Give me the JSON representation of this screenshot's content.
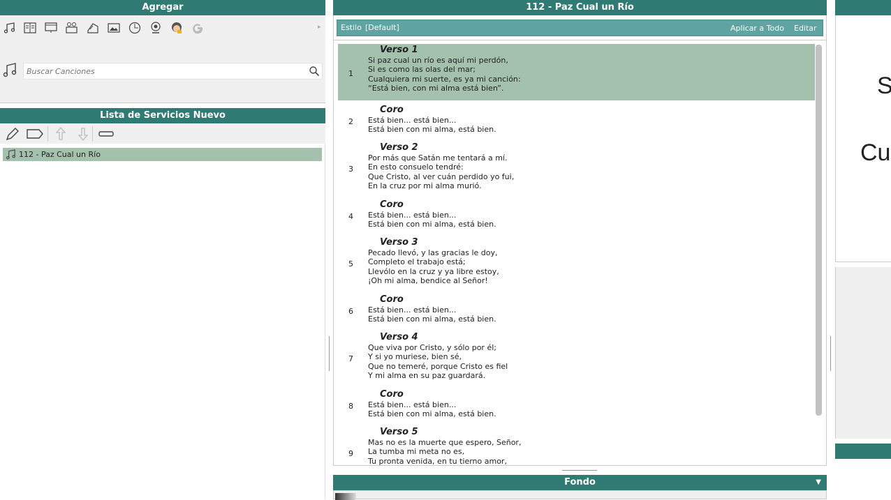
{
  "left": {
    "add_title": "Agregar",
    "search_placeholder": "Buscar Canciones",
    "service_title": "Lista de Servicios Nuevo",
    "service_items": [
      "112 - Paz Cual un Río"
    ]
  },
  "center": {
    "song_title": "112 - Paz Cual un Río",
    "style_label": "Estilo",
    "style_value": "[Default]",
    "apply_all": "Aplicar a Todo",
    "edit": "Editar",
    "verses": [
      {
        "num": "1",
        "title": "Verso 1",
        "lines": [
          "Si paz cual un río es aquí mi perdón,",
          "Si es como las olas del mar;",
          "Cualquiera mi suerte, es ya mi canción:",
          "“Está bien, con mi alma está bien”."
        ]
      },
      {
        "num": "2",
        "title": "Coro",
        "lines": [
          "Está bien... está bien...",
          "Está bien con mi alma, está bien."
        ]
      },
      {
        "num": "3",
        "title": "Verso 2",
        "lines": [
          "Por más que Satán me tentará a mí.",
          "En esto consuelo tendré:",
          "Que Cristo, al ver cuán perdido yo fui,",
          "En la cruz por mi alma murió."
        ]
      },
      {
        "num": "4",
        "title": "Coro",
        "lines": [
          "Está bien... está bien...",
          "Está bien con mi alma, está bien."
        ]
      },
      {
        "num": "5",
        "title": "Verso 3",
        "lines": [
          "Pecado llevó, y las gracias le doy,",
          "Completo el trabajo está;",
          "Llevólo en la cruz y ya libre estoy,",
          "¡Oh mi alma, bendice al Señor!"
        ]
      },
      {
        "num": "6",
        "title": "Coro",
        "lines": [
          "Está bien... está bien...",
          "Está bien con mi alma, está bien."
        ]
      },
      {
        "num": "7",
        "title": "Verso 4",
        "lines": [
          "Que viva por Cristo, y sólo por él;",
          "Y si yo muriese, bien sé,",
          "Que no temeré, porque Cristo es fiel",
          "Y mi alma en su paz guardará."
        ]
      },
      {
        "num": "8",
        "title": "Coro",
        "lines": [
          "Está bien... está bien...",
          "Está bien con mi alma, está bien."
        ]
      },
      {
        "num": "9",
        "title": "Verso 5",
        "lines": [
          "Mas no es la muerte que espero, Señor,",
          "La tumba mi meta no es,",
          "Tu pronta venida, en tu tierno amor,"
        ]
      }
    ],
    "background_title": "Fondo"
  },
  "right": {
    "preview_text_1": "S",
    "preview_text_2": "Cu"
  }
}
